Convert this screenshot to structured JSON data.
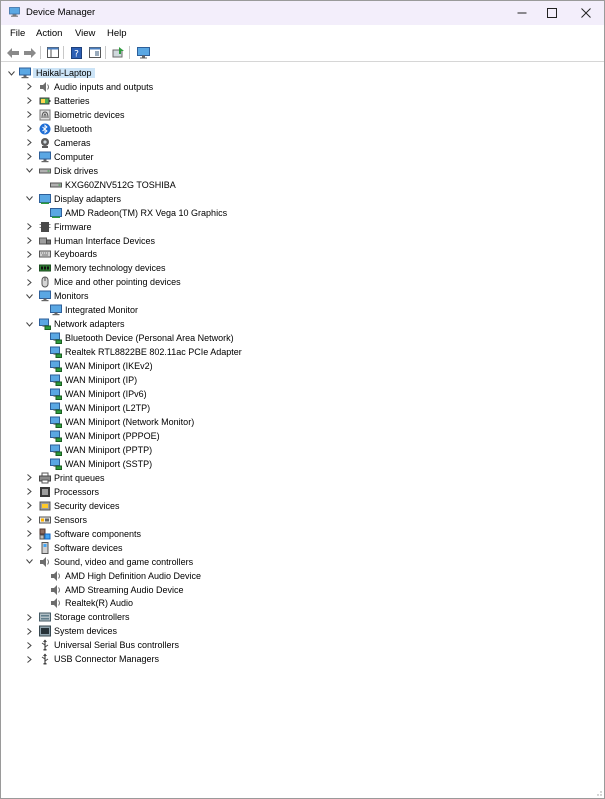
{
  "window": {
    "title": "Device Manager"
  },
  "menu": [
    "File",
    "Action",
    "View",
    "Help"
  ],
  "tree": {
    "root": "Haikal-Laptop",
    "rows": [
      {
        "depth": 1,
        "label": "Audio inputs and outputs",
        "icon": "speaker-icon",
        "state": "collapsed"
      },
      {
        "depth": 1,
        "label": "Batteries",
        "icon": "battery-icon",
        "state": "collapsed"
      },
      {
        "depth": 1,
        "label": "Biometric devices",
        "icon": "fingerprint-icon",
        "state": "collapsed"
      },
      {
        "depth": 1,
        "label": "Bluetooth",
        "icon": "bluetooth-icon",
        "state": "collapsed"
      },
      {
        "depth": 1,
        "label": "Cameras",
        "icon": "camera-icon",
        "state": "collapsed"
      },
      {
        "depth": 1,
        "label": "Computer",
        "icon": "computer-icon",
        "state": "collapsed"
      },
      {
        "depth": 1,
        "label": "Disk drives",
        "icon": "disk-icon",
        "state": "expanded"
      },
      {
        "depth": 2,
        "label": "KXG60ZNV512G TOSHIBA",
        "icon": "disk-icon",
        "state": "leaf"
      },
      {
        "depth": 1,
        "label": "Display adapters",
        "icon": "display-adapter-icon",
        "state": "expanded"
      },
      {
        "depth": 2,
        "label": "AMD Radeon(TM) RX Vega 10 Graphics",
        "icon": "display-adapter-icon",
        "state": "leaf"
      },
      {
        "depth": 1,
        "label": "Firmware",
        "icon": "firmware-icon",
        "state": "collapsed"
      },
      {
        "depth": 1,
        "label": "Human Interface Devices",
        "icon": "hid-icon",
        "state": "collapsed"
      },
      {
        "depth": 1,
        "label": "Keyboards",
        "icon": "keyboard-icon",
        "state": "collapsed"
      },
      {
        "depth": 1,
        "label": "Memory technology devices",
        "icon": "memory-icon",
        "state": "collapsed"
      },
      {
        "depth": 1,
        "label": "Mice and other pointing devices",
        "icon": "mouse-icon",
        "state": "collapsed"
      },
      {
        "depth": 1,
        "label": "Monitors",
        "icon": "monitor-icon",
        "state": "expanded"
      },
      {
        "depth": 2,
        "label": "Integrated Monitor",
        "icon": "monitor-icon",
        "state": "leaf"
      },
      {
        "depth": 1,
        "label": "Network adapters",
        "icon": "network-icon",
        "state": "expanded"
      },
      {
        "depth": 2,
        "label": "Bluetooth Device (Personal Area Network)",
        "icon": "network-icon",
        "state": "leaf"
      },
      {
        "depth": 2,
        "label": "Realtek RTL8822BE 802.11ac PCIe Adapter",
        "icon": "network-icon",
        "state": "leaf"
      },
      {
        "depth": 2,
        "label": "WAN Miniport (IKEv2)",
        "icon": "network-icon",
        "state": "leaf"
      },
      {
        "depth": 2,
        "label": "WAN Miniport (IP)",
        "icon": "network-icon",
        "state": "leaf"
      },
      {
        "depth": 2,
        "label": "WAN Miniport (IPv6)",
        "icon": "network-icon",
        "state": "leaf"
      },
      {
        "depth": 2,
        "label": "WAN Miniport (L2TP)",
        "icon": "network-icon",
        "state": "leaf"
      },
      {
        "depth": 2,
        "label": "WAN Miniport (Network Monitor)",
        "icon": "network-icon",
        "state": "leaf"
      },
      {
        "depth": 2,
        "label": "WAN Miniport (PPPOE)",
        "icon": "network-icon",
        "state": "leaf"
      },
      {
        "depth": 2,
        "label": "WAN Miniport (PPTP)",
        "icon": "network-icon",
        "state": "leaf"
      },
      {
        "depth": 2,
        "label": "WAN Miniport (SSTP)",
        "icon": "network-icon",
        "state": "leaf"
      },
      {
        "depth": 1,
        "label": "Print queues",
        "icon": "printer-icon",
        "state": "collapsed"
      },
      {
        "depth": 1,
        "label": "Processors",
        "icon": "processor-icon",
        "state": "collapsed"
      },
      {
        "depth": 1,
        "label": "Security devices",
        "icon": "security-icon",
        "state": "collapsed"
      },
      {
        "depth": 1,
        "label": "Sensors",
        "icon": "sensor-icon",
        "state": "collapsed"
      },
      {
        "depth": 1,
        "label": "Software components",
        "icon": "software-component-icon",
        "state": "collapsed"
      },
      {
        "depth": 1,
        "label": "Software devices",
        "icon": "software-device-icon",
        "state": "collapsed"
      },
      {
        "depth": 1,
        "label": "Sound, video and game controllers",
        "icon": "sound-icon",
        "state": "expanded"
      },
      {
        "depth": 2,
        "label": "AMD High Definition Audio Device",
        "icon": "sound-icon",
        "state": "leaf"
      },
      {
        "depth": 2,
        "label": "AMD Streaming Audio Device",
        "icon": "sound-icon",
        "state": "leaf"
      },
      {
        "depth": 2,
        "label": "Realtek(R) Audio",
        "icon": "sound-icon",
        "state": "leaf"
      },
      {
        "depth": 1,
        "label": "Storage controllers",
        "icon": "storage-icon",
        "state": "collapsed"
      },
      {
        "depth": 1,
        "label": "System devices",
        "icon": "system-icon",
        "state": "collapsed"
      },
      {
        "depth": 1,
        "label": "Universal Serial Bus controllers",
        "icon": "usb-icon",
        "state": "collapsed"
      },
      {
        "depth": 1,
        "label": "USB Connector Managers",
        "icon": "usb-icon",
        "state": "collapsed"
      }
    ]
  },
  "colors": {
    "titlebar": "#f3eefb",
    "selection": "#cce4f7",
    "icon_blue": "#1e88d6",
    "icon_gray": "#7a7a7a"
  }
}
